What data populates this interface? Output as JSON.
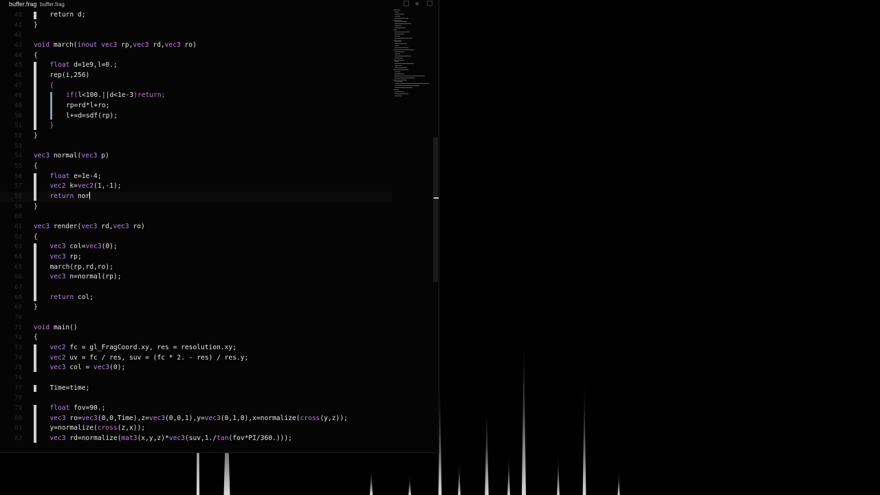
{
  "tabs": [
    "buffer.frag",
    "buffer.frag"
  ],
  "lines": [
    {
      "n": "40",
      "segs": [
        [
          "return d;",
          ""
        ]
      ]
    },
    {
      "n": "41",
      "segs": [
        [
          "}",
          ""
        ]
      ]
    },
    {
      "n": "42",
      "segs": []
    },
    {
      "n": "43",
      "segs": [
        [
          "void ",
          "kw"
        ],
        [
          "march(",
          ""
        ],
        [
          "inout vec3 ",
          "ty"
        ],
        [
          "rp,",
          ""
        ],
        [
          "vec3 ",
          "ty"
        ],
        [
          "rd,",
          ""
        ],
        [
          "vec3 ",
          "ty"
        ],
        [
          "ro)",
          ""
        ]
      ]
    },
    {
      "n": "44",
      "segs": [
        [
          "{",
          ""
        ]
      ]
    },
    {
      "n": "45",
      "segs": [
        [
          "float ",
          "ty"
        ],
        [
          "d=1e9,l=0.;",
          ""
        ]
      ]
    },
    {
      "n": "46",
      "segs": [
        [
          "rep(i,256)",
          ""
        ]
      ]
    },
    {
      "n": "47",
      "segs": [
        [
          "{",
          "kw"
        ]
      ]
    },
    {
      "n": "48",
      "segs": [
        [
          "if(",
          "kw"
        ],
        [
          "l<100.||d<1e-3",
          ""
        ],
        [
          ")return;",
          "kw"
        ]
      ]
    },
    {
      "n": "49",
      "segs": [
        [
          "rp=rd*l+ro;",
          ""
        ]
      ]
    },
    {
      "n": "50",
      "segs": [
        [
          "l+=d=sdf(rp);",
          ""
        ]
      ]
    },
    {
      "n": "51",
      "segs": [
        [
          "}",
          "kw"
        ]
      ]
    },
    {
      "n": "52",
      "segs": [
        [
          "}",
          ""
        ]
      ]
    },
    {
      "n": "53",
      "segs": []
    },
    {
      "n": "54",
      "segs": [
        [
          "vec3 ",
          "ty"
        ],
        [
          "normal(",
          ""
        ],
        [
          "vec3 ",
          "ty"
        ],
        [
          "p)",
          ""
        ]
      ]
    },
    {
      "n": "55",
      "segs": [
        [
          "{",
          ""
        ]
      ]
    },
    {
      "n": "56",
      "segs": [
        [
          "float ",
          "ty"
        ],
        [
          "e=1e-4;",
          ""
        ]
      ]
    },
    {
      "n": "57",
      "segs": [
        [
          "vec2 ",
          "ty"
        ],
        [
          "k=",
          ""
        ],
        [
          "vec2",
          "ty"
        ],
        [
          "(1,-1);",
          ""
        ]
      ]
    },
    {
      "n": "58",
      "segs": [
        [
          "return ",
          "ty"
        ],
        [
          "nor",
          ""
        ]
      ]
    },
    {
      "n": "59",
      "segs": [
        [
          "}",
          ""
        ]
      ]
    },
    {
      "n": "60",
      "segs": []
    },
    {
      "n": "61",
      "segs": [
        [
          "vec3 ",
          "ty"
        ],
        [
          "render(",
          ""
        ],
        [
          "vec3 ",
          "ty"
        ],
        [
          "rd,",
          ""
        ],
        [
          "vec3 ",
          "ty"
        ],
        [
          "ro)",
          ""
        ]
      ]
    },
    {
      "n": "62",
      "segs": [
        [
          "{",
          ""
        ]
      ]
    },
    {
      "n": "63",
      "segs": [
        [
          "vec3 ",
          "ty"
        ],
        [
          "col=",
          ""
        ],
        [
          "vec3",
          "ty"
        ],
        [
          "(0);",
          ""
        ]
      ]
    },
    {
      "n": "64",
      "segs": [
        [
          "vec3 ",
          "ty"
        ],
        [
          "rp;",
          ""
        ]
      ]
    },
    {
      "n": "65",
      "segs": [
        [
          "march(rp,rd,ro);",
          ""
        ]
      ]
    },
    {
      "n": "66",
      "segs": [
        [
          "vec3 ",
          "ty"
        ],
        [
          "n=normal(rp);",
          ""
        ]
      ]
    },
    {
      "n": "67",
      "segs": []
    },
    {
      "n": "68",
      "segs": [
        [
          "return ",
          "ty"
        ],
        [
          "col;",
          ""
        ]
      ]
    },
    {
      "n": "69",
      "segs": [
        [
          "}",
          ""
        ]
      ]
    },
    {
      "n": "70",
      "segs": []
    },
    {
      "n": "71",
      "segs": [
        [
          "void ",
          "kw"
        ],
        [
          "main()",
          ""
        ]
      ]
    },
    {
      "n": "72",
      "segs": [
        [
          "{",
          ""
        ]
      ]
    },
    {
      "n": "73",
      "segs": [
        [
          "vec2 ",
          "ty"
        ],
        [
          "fc = gl_FragCoord.xy, res = resolution.xy;",
          ""
        ]
      ]
    },
    {
      "n": "74",
      "segs": [
        [
          "vec2 ",
          "ty"
        ],
        [
          "uv = fc / res, suv = (fc * 2. - res) / res.y;",
          ""
        ]
      ]
    },
    {
      "n": "75",
      "segs": [
        [
          "vec3 ",
          "ty"
        ],
        [
          "col = ",
          ""
        ],
        [
          "vec3",
          "ty"
        ],
        [
          "(0);",
          ""
        ]
      ]
    },
    {
      "n": "76",
      "segs": []
    },
    {
      "n": "77",
      "segs": [
        [
          "Time=time;",
          ""
        ]
      ]
    },
    {
      "n": "78",
      "segs": []
    },
    {
      "n": "79",
      "segs": [
        [
          "float ",
          "ty"
        ],
        [
          "fov=90.;",
          ""
        ]
      ]
    },
    {
      "n": "80",
      "segs": [
        [
          "vec3 ",
          "ty"
        ],
        [
          "ro=",
          ""
        ],
        [
          "vec3",
          "ty"
        ],
        [
          "(0,0,Time),z=",
          ""
        ],
        [
          "vec3",
          "ty"
        ],
        [
          "(0,0,1),y=",
          ""
        ],
        [
          "vec3",
          "ty"
        ],
        [
          "(0,1,0),x=normalize(",
          ""
        ],
        [
          "cross",
          "kw"
        ],
        [
          "(y,z));",
          ""
        ]
      ]
    },
    {
      "n": "81",
      "segs": [
        [
          "y=normalize(",
          ""
        ],
        [
          "cross",
          "kw"
        ],
        [
          "(z,x));",
          ""
        ]
      ]
    },
    {
      "n": "82",
      "segs": [
        [
          "vec3 ",
          "ty"
        ],
        [
          "rd=normalize(",
          ""
        ],
        [
          "mat3",
          "ty"
        ],
        [
          "(x,y,z)*",
          ""
        ],
        [
          "vec3",
          "ty"
        ],
        [
          "(suv,1./",
          ""
        ],
        [
          "tan",
          "kw"
        ],
        [
          "(fov*PI/360.)));",
          ""
        ]
      ]
    }
  ],
  "cursor_line": "58",
  "colors": {
    "keyword": "#c07bd0",
    "type": "#b986e8",
    "text": "#e8e8e8",
    "background": "#050505"
  }
}
